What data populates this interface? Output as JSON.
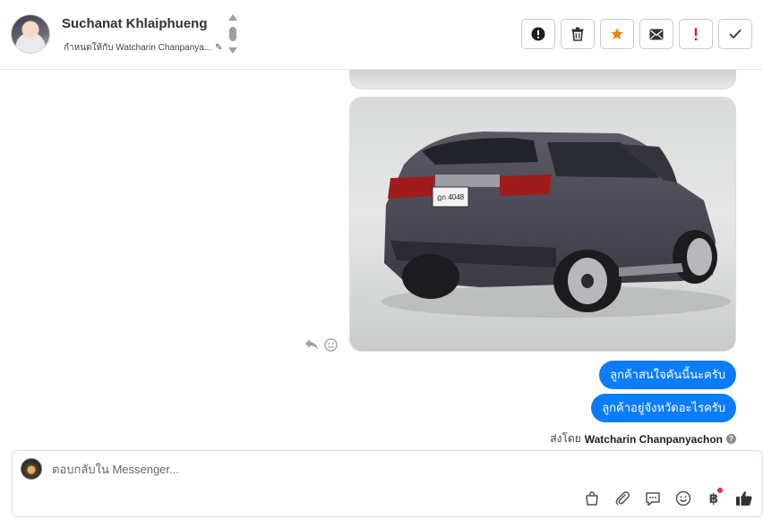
{
  "header": {
    "contact_name": "Suchanat Khlaiphueng",
    "assigned_label": "กำหนดให้กับ Watcharin Chanpanya...",
    "pencil_icon": "✎"
  },
  "toolbar": [
    {
      "name": "spam-button",
      "icon": "alert-circle-icon"
    },
    {
      "name": "delete-button",
      "icon": "trash-icon"
    },
    {
      "name": "star-button",
      "icon": "star-icon",
      "color": "#f5820b"
    },
    {
      "name": "mark-unread-button",
      "icon": "envelope-icon"
    },
    {
      "name": "follow-up-button",
      "icon": "exclamation-icon",
      "color": "#e02020"
    },
    {
      "name": "done-button",
      "icon": "check-icon"
    }
  ],
  "messages": {
    "bubble1": "ลูกค้าสนใจคันนี้นะครับ",
    "bubble2": "ลูกค้าอยู่จังหวัดอะไรครับ",
    "sent_by_label": "ส่งโดย",
    "sent_by_name": "Watcharin Chanpanyachon",
    "plate_text": "ฎก 4048",
    "accent": "#0a7cff"
  },
  "composer": {
    "placeholder": "ตอบกลับใน Messenger...",
    "currency_symbol": "฿"
  }
}
